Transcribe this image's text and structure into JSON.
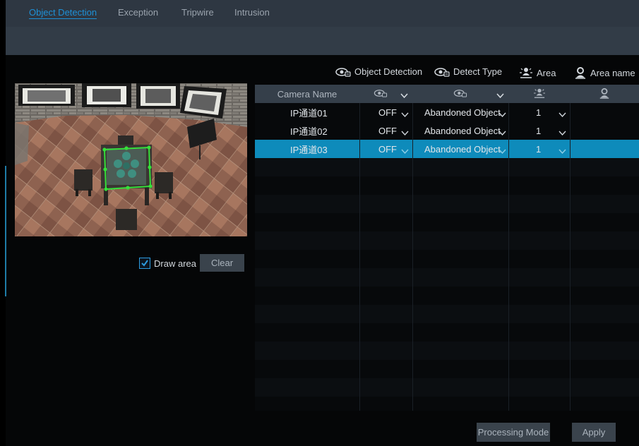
{
  "tabs": [
    {
      "label": "Object Detection",
      "active": true
    },
    {
      "label": "Exception",
      "active": false
    },
    {
      "label": "Tripwire",
      "active": false
    },
    {
      "label": "Intrusion",
      "active": false
    }
  ],
  "legend": {
    "object_detection": "Object Detection",
    "detect_type": "Detect Type",
    "area": "Area",
    "area_name": "Area name"
  },
  "draw_area": {
    "label": "Draw area",
    "checked": true
  },
  "buttons": {
    "clear": "Clear",
    "processing_mode": "Processing Mode",
    "apply": "Apply"
  },
  "table": {
    "header_camera": "Camera Name",
    "rows": [
      {
        "camera": "IP通道01",
        "state": "OFF",
        "type": "Abandoned Object",
        "area": "1",
        "selected": false
      },
      {
        "camera": "IP通道02",
        "state": "OFF",
        "type": "Abandoned Object",
        "area": "1",
        "selected": false
      },
      {
        "camera": "IP通道03",
        "state": "OFF",
        "type": "Abandoned Object",
        "area": "1",
        "selected": true
      }
    ]
  },
  "colors": {
    "accent": "#1e90d6",
    "selected_row": "#0e8bbb",
    "detection_box": "#35e03a"
  },
  "icons": {
    "object_detection": "eye-detect-icon",
    "detect_type": "eye-detect-icon",
    "area": "area-person-icon",
    "area_name": "user-pin-icon",
    "chevron": "chevron-down-icon"
  }
}
